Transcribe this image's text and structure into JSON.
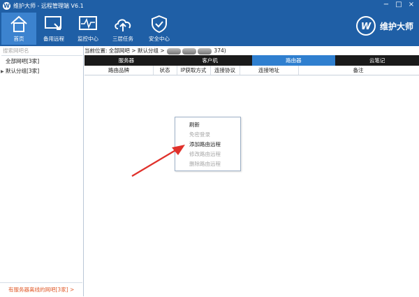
{
  "window": {
    "title": "维护大师 - 远程管理端 V6.1",
    "logo_text": "W",
    "controls": [
      "minimize-icon",
      "restore-icon",
      "close-icon"
    ],
    "control_glyphs": [
      "−",
      "□",
      "×"
    ]
  },
  "toolbar": {
    "items": [
      {
        "label": "首页",
        "icon": "home-icon",
        "active": true
      },
      {
        "label": "备用远程",
        "icon": "remote-arrow-icon",
        "active": false
      },
      {
        "label": "监控中心",
        "icon": "pulse-monitor-icon",
        "active": false
      },
      {
        "label": "三层任务",
        "icon": "cloud-upload-icon",
        "active": false
      },
      {
        "label": "安全中心",
        "icon": "shield-check-icon",
        "active": false
      }
    ]
  },
  "brand": {
    "logo_text": "W",
    "name": "维护大师"
  },
  "sidebar": {
    "search_placeholder": "搜索网吧名",
    "items": [
      {
        "label": "全部网吧[3家]",
        "expandable": false
      },
      {
        "label": "默认分组[3家]",
        "expandable": true
      }
    ],
    "footer_link": "有服务器离线的网吧[3家] >"
  },
  "breadcrumb": {
    "prefix": "当前位置: 全部网吧 > 默认分组 >",
    "suffix": "374)"
  },
  "tabs": [
    {
      "label": "服务器",
      "active": false
    },
    {
      "label": "客户机",
      "active": false
    },
    {
      "label": "路由器",
      "active": true
    },
    {
      "label": "云笔记",
      "active": false
    }
  ],
  "table": {
    "columns": [
      "路由品牌",
      "状态",
      "IP获取方式",
      "连接协议",
      "连接地址",
      "备注"
    ],
    "rows": []
  },
  "context_menu": {
    "items": [
      {
        "label": "刷新",
        "disabled": false
      },
      {
        "label": "免密登录",
        "disabled": true
      },
      {
        "label": "添加路由远程",
        "disabled": false
      },
      {
        "label": "修改路由远程",
        "disabled": true
      },
      {
        "label": "删除路由远程",
        "disabled": true
      }
    ]
  },
  "colors": {
    "titlebar": "#1f5fa6",
    "active_tab": "#2f7fcf",
    "tab_bar": "#1a1a1a",
    "annotation_arrow": "#e0312b",
    "footer_link": "#e05a2a"
  }
}
